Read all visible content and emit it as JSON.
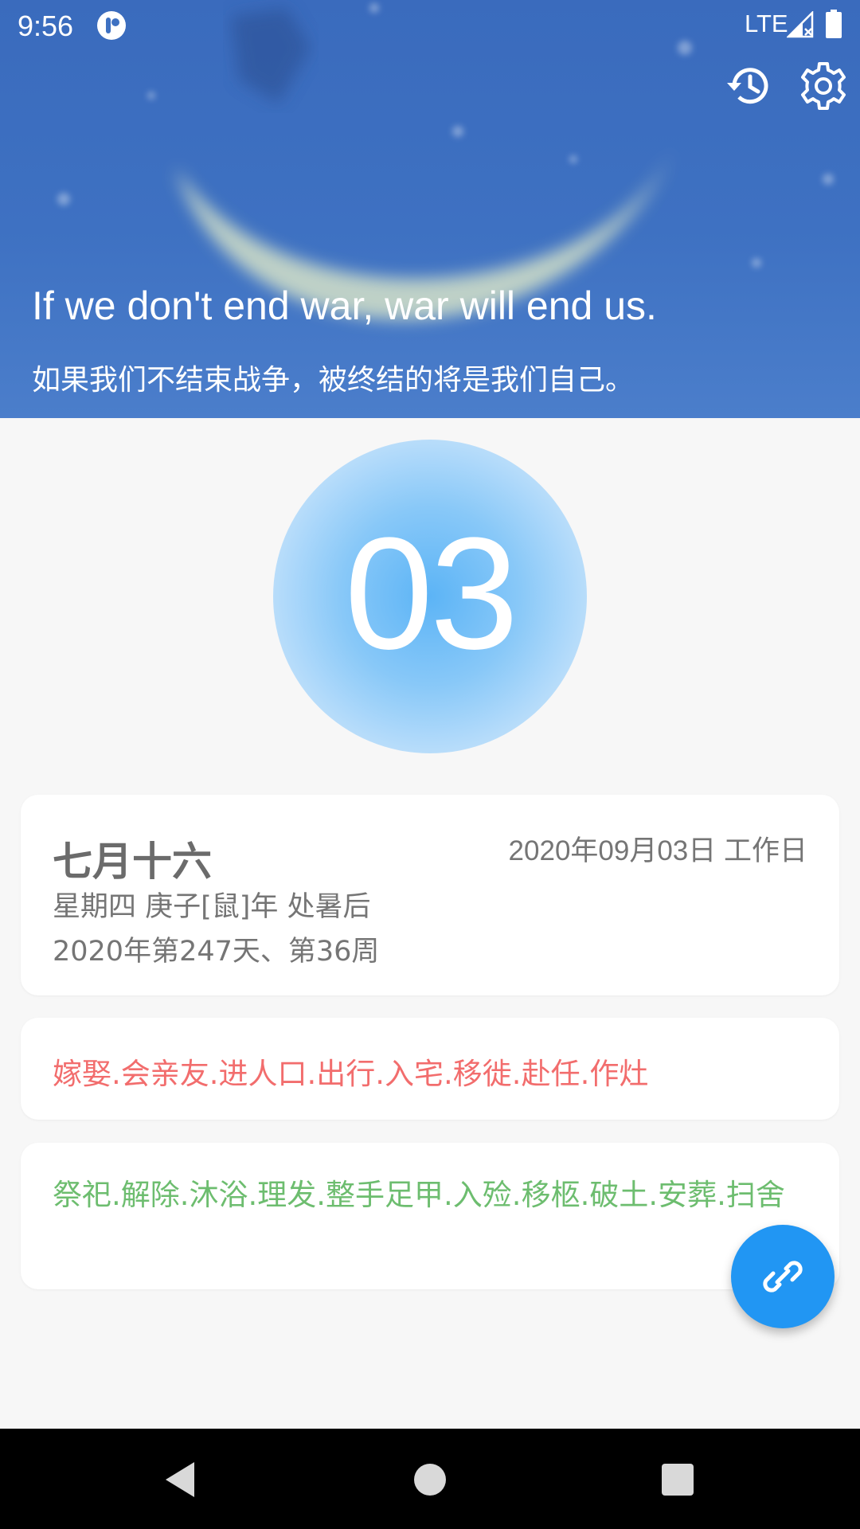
{
  "status_bar": {
    "time": "9:56",
    "network": "LTE",
    "icons": [
      "app-notification-icon",
      "signal-icon",
      "battery-icon"
    ]
  },
  "header": {
    "quote_en": "If we don't end war, war will end us.",
    "quote_zh": "如果我们不结束战争，被终结的将是我们自己。",
    "actions": [
      "history-icon",
      "settings-icon"
    ]
  },
  "day": {
    "number": "03"
  },
  "info_card": {
    "lunar_date": "七月十六",
    "solar_date": "2020年09月03日 工作日",
    "line1": "星期四 庚子[鼠]年 处暑后",
    "line2": "2020年第247天、第36周"
  },
  "suitable": {
    "text": "嫁娶.会亲友.进人口.出行.入宅.移徙.赴任.作灶"
  },
  "avoid": {
    "text": "祭祀.解除.沐浴.理发.整手足甲.入殓.移柩.破土.安葬.扫舍"
  },
  "fab": {
    "icon": "link-icon"
  },
  "nav_bar": {
    "buttons": [
      "back-icon",
      "home-icon",
      "recents-icon"
    ]
  },
  "colors": {
    "header_blue": "#3e71c2",
    "fab_blue": "#2196f3",
    "suitable_red": "#f26d6d",
    "avoid_green": "#6dbd6f"
  }
}
